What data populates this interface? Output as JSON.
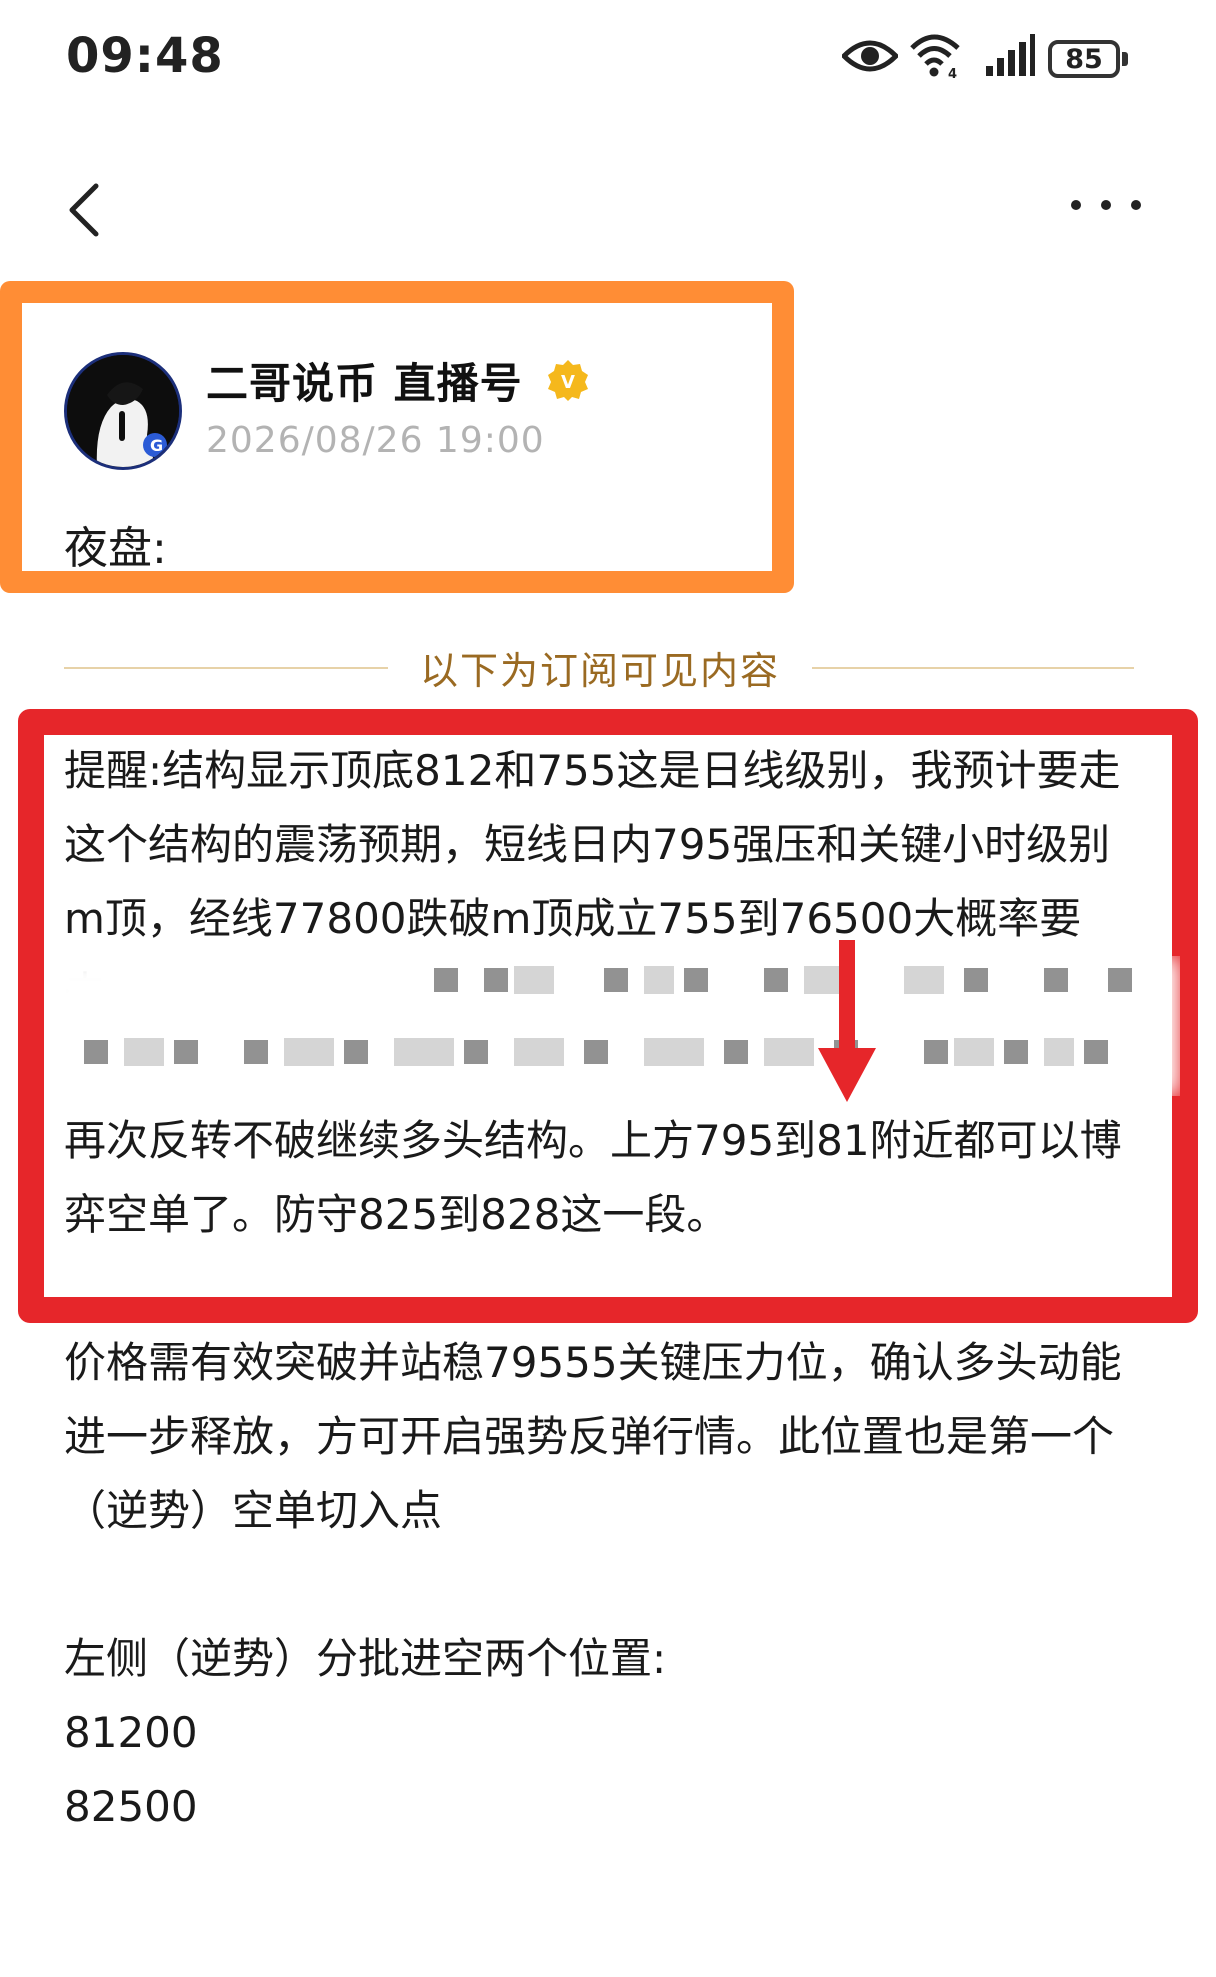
{
  "status_bar": {
    "time": "09:48",
    "battery": "85",
    "icons": [
      "eye-icon",
      "wifi-icon",
      "signal-icon",
      "battery-icon"
    ]
  },
  "nav": {
    "back_icon": "chevron-left-icon",
    "more_icon": "more-dots-icon"
  },
  "post": {
    "author": "二哥说币 直播号",
    "verified_badge": "V",
    "date": "2026/08/26 19:00",
    "intro": "夜盘:"
  },
  "paywall": {
    "divider_label": "以下为订阅可见内容",
    "visible_lines": [
      "提醒:结构显示顶底812和755这是日线级别，我预计要走这个结构的震荡预期，短线日内795强压和关键小时级别m顶，经线77800跌破m顶成立755到76500大概率要去，",
      "再次反转不破继续多头结构。上方795到81附近都可以博弈空单了。防守825到828这一段。"
    ]
  },
  "body": {
    "paragraph": "价格需有效突破并站稳79555关键压力位，确认多头动能进一步释放，方可开启强势反弹行情。此位置也是第一个（逆势）空单切入点",
    "left_side_title": "左侧（逆势）分批进空两个位置:",
    "positions": [
      "81200",
      "82500"
    ]
  },
  "colors": {
    "orange_highlight": "#ff8d35",
    "red_highlight": "#e6262a",
    "divider_gold": "#9a6a22",
    "verified_gold": "#f5b81c"
  }
}
